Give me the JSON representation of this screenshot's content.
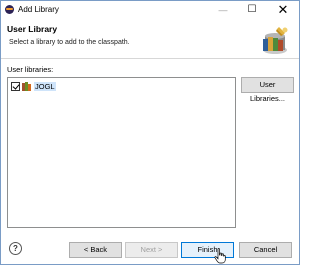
{
  "window": {
    "title": "Add Library",
    "minimize_glyph": "—",
    "maximize_glyph": "☐",
    "close_glyph": "✕"
  },
  "header": {
    "title": "User Library",
    "description": "Select a library to add to the classpath."
  },
  "main": {
    "list_label": "User libraries:",
    "libraries": [
      {
        "name": "JOGL",
        "checked": true,
        "icon": "library-books-icon"
      }
    ],
    "user_libraries_button": "User Libraries..."
  },
  "footer": {
    "help_glyph": "?",
    "back_label": "< Back",
    "next_label": "Next >",
    "finish_label": "Finish",
    "cancel_label": "Cancel"
  },
  "colors": {
    "window_border": "#7a9cc6",
    "selection": "#cfe4fa",
    "default_button_border": "#0078d7"
  }
}
